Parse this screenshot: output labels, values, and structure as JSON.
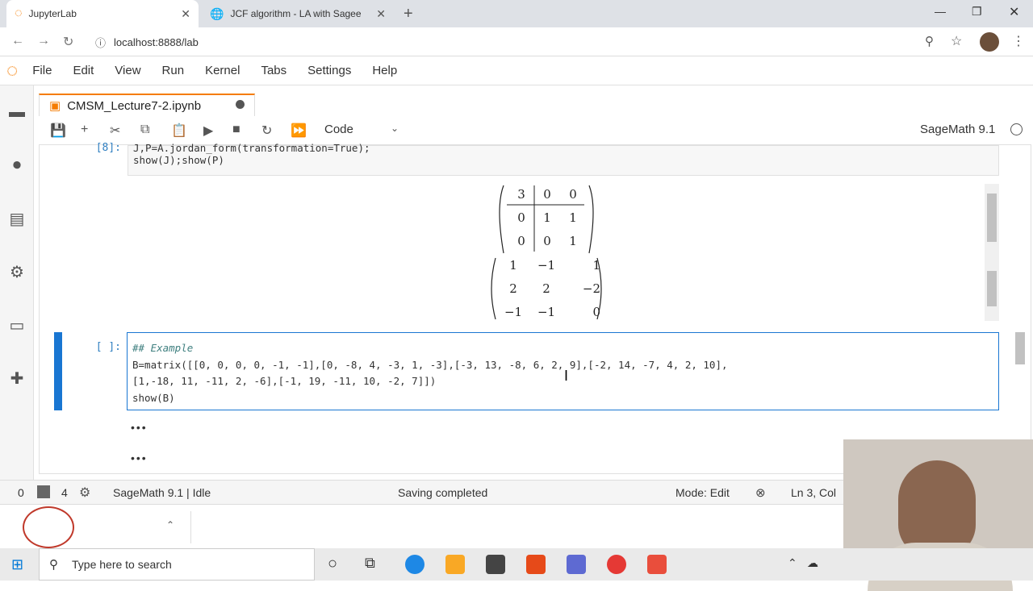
{
  "browser": {
    "tabs": [
      {
        "label": "JupyterLab"
      },
      {
        "label": "JCF algorithm - LA with Sagee"
      }
    ],
    "url": "localhost:8888/lab"
  },
  "menu": [
    "File",
    "Edit",
    "View",
    "Run",
    "Kernel",
    "Tabs",
    "Settings",
    "Help"
  ],
  "notebook": {
    "tab_title": "CMSM_Lecture7-2.ipynb",
    "cell_type": "Code",
    "kernel_name": "SageMath 9.1",
    "prev_prompt": "[8]:",
    "prev_line1": "J,P=A.jordan_form(transformation=True);",
    "prev_line2": "show(J);show(P)",
    "matrix_J": [
      [
        "3",
        "0",
        "0"
      ],
      [
        "0",
        "1",
        "1"
      ],
      [
        "0",
        "0",
        "1"
      ]
    ],
    "matrix_P": [
      [
        "1",
        "−1",
        "1"
      ],
      [
        "2",
        "2",
        "−2"
      ],
      [
        "−1",
        "−1",
        "0"
      ]
    ],
    "active_prompt": "[ ]:",
    "active_line1": "## Example",
    "active_line2": "B=matrix([[0, 0, 0, 0, -1, -1],[0, -8, 4, -3, 1, -3],[-3, 13, -8, 6, 2, 9],[-2, 14, -7, 4, 2, 10],",
    "active_line3": "[1,-18, 11, -11, 2, -6],[-1, 19, -11, 10, -2, 7]])",
    "active_line4": "show(B)",
    "ellipsis": "•••"
  },
  "status": {
    "left_count_a": "0",
    "left_count_b": "4",
    "kernel_status": "SageMath 9.1 | Idle",
    "message": "Saving completed",
    "mode": "Mode: Edit",
    "position": "Ln 3, Col"
  },
  "taskbar": {
    "search_placeholder": "Type here to search"
  },
  "colors": {
    "accent": "#f57c00",
    "active_cell": "#1976d2",
    "prompt": "#307fc1"
  }
}
